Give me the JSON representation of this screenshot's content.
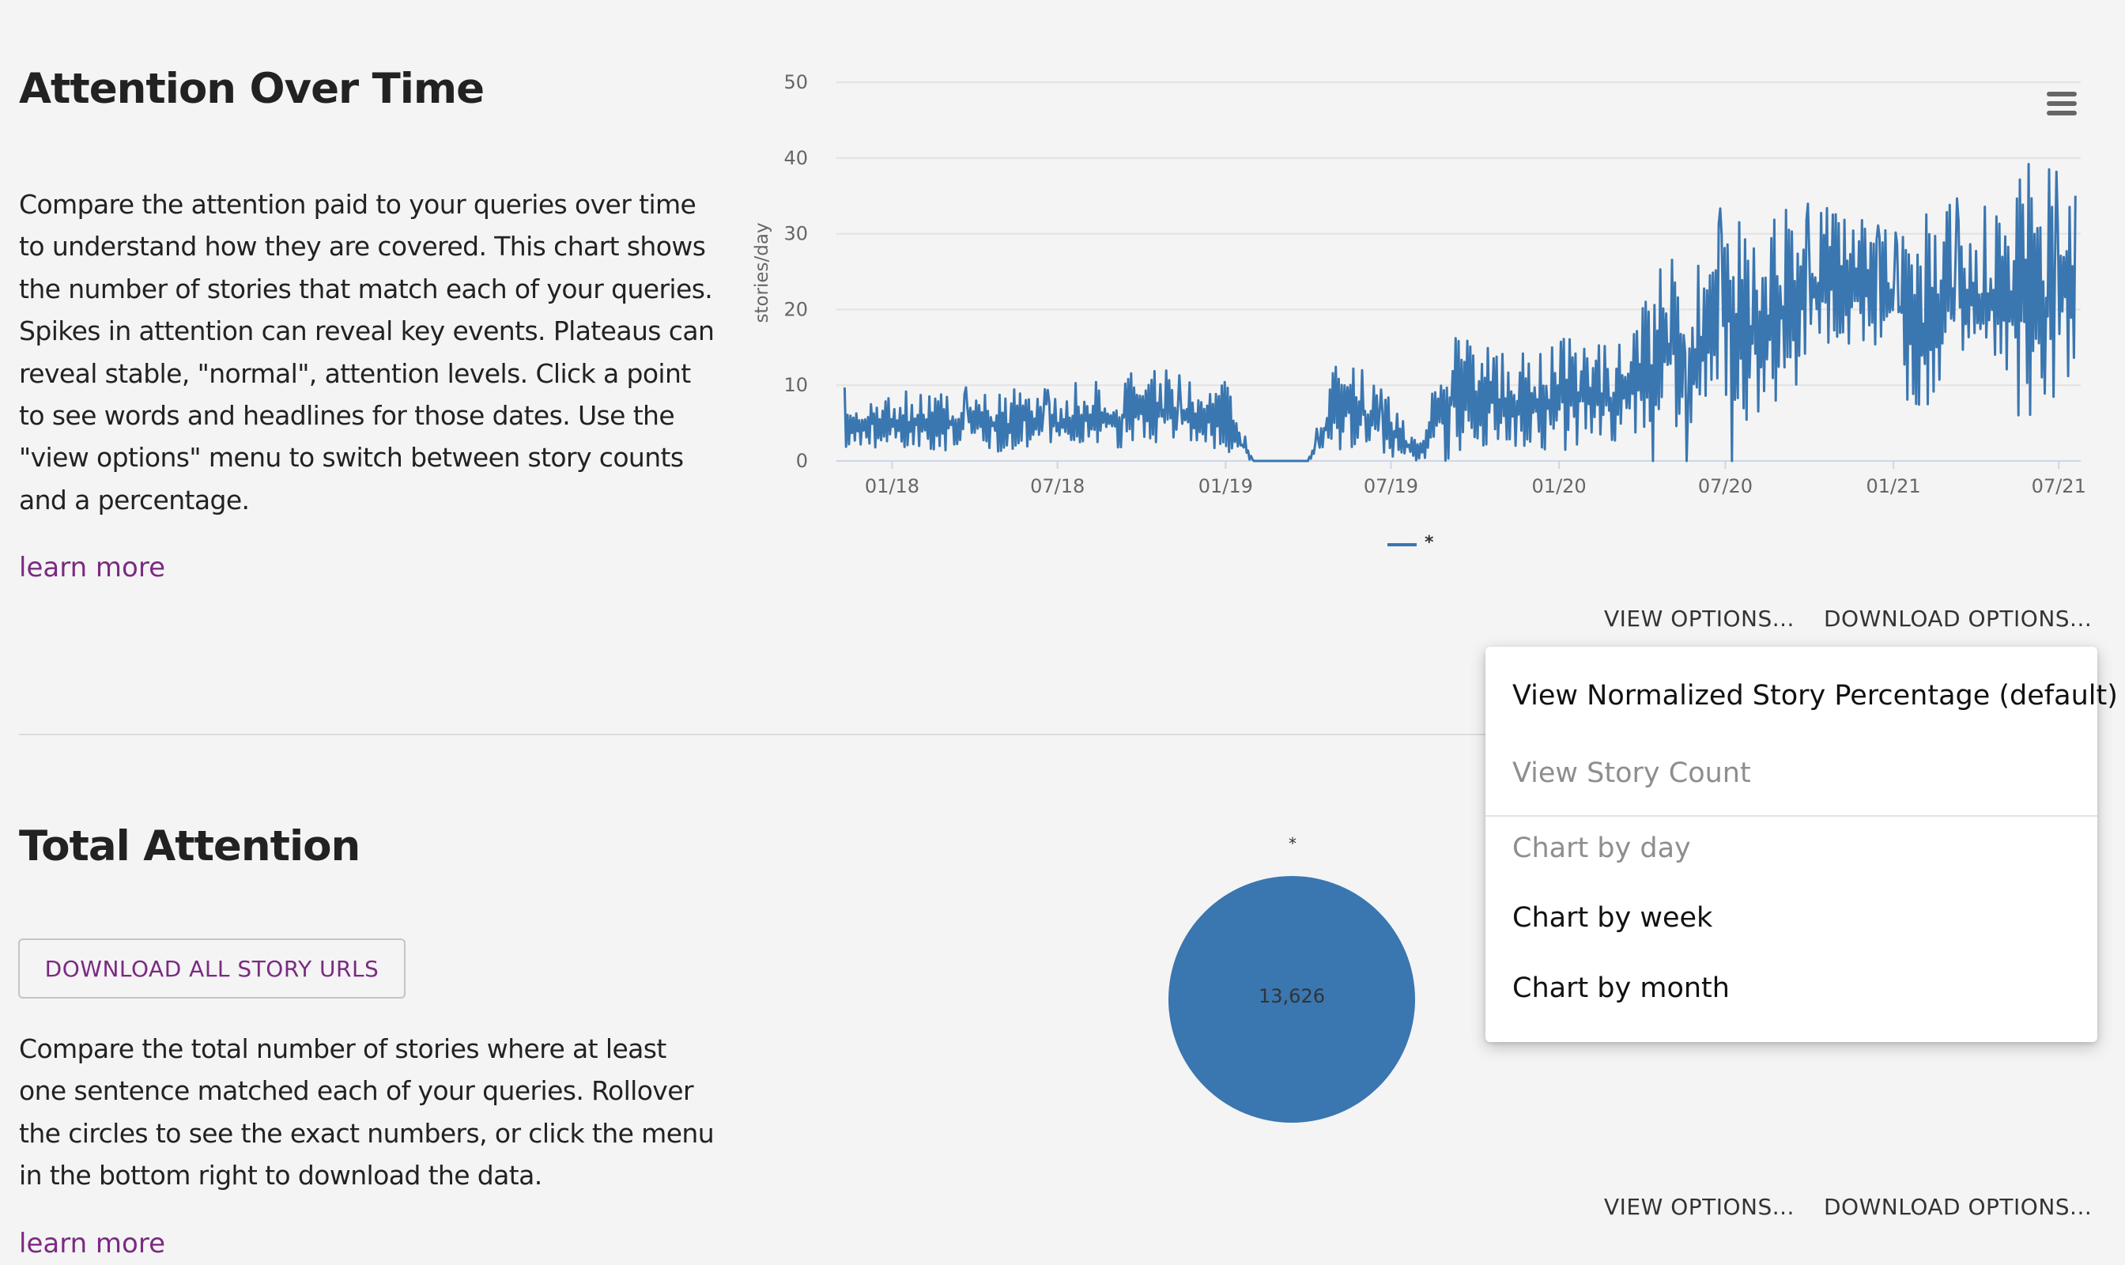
{
  "attention_over_time": {
    "title": "Attention Over Time",
    "description": "Compare the attention paid to your queries over time to understand how they are covered. This chart shows the number of stories that match each of your queries. Spikes in attention can reveal key events. Plateaus can reveal stable, \"normal\", attention levels. Click a point to see words and headlines for those dates. Use the \"view options\" menu to switch between story counts and a percentage.",
    "learn_more": "learn more",
    "view_options": "VIEW OPTIONS...",
    "download_options": "DOWNLOAD OPTIONS..."
  },
  "total_attention": {
    "title": "Total Attention",
    "download_button": "DOWNLOAD ALL STORY URLS",
    "description": "Compare the total number of stories where at least one sentence matched each of your queries. Rollover the circles to see the exact numbers, or click the menu in the bottom right to download the data.",
    "learn_more": "learn more",
    "bubble_label": "*",
    "bubble_value": "13,626",
    "view_options": "VIEW OPTIONS...",
    "download_options": "DOWNLOAD OPTIONS..."
  },
  "view_menu": {
    "items": [
      {
        "label": "View Normalized Story Percentage (default)",
        "state": "active"
      },
      {
        "label": "View Story Count",
        "state": "disabled"
      },
      {
        "label": "Chart by day",
        "state": "disabled"
      },
      {
        "label": "Chart by week",
        "state": "active"
      },
      {
        "label": "Chart by month",
        "state": "active"
      }
    ]
  },
  "colors": {
    "series": "#3a76b0",
    "link": "#7b2a82",
    "background": "#f4f4f4"
  },
  "chart_menu_icon": "hamburger-menu-icon",
  "chart_data": {
    "type": "line",
    "title": "",
    "xlabel": "",
    "ylabel": "stories/day",
    "ylim": [
      0,
      50
    ],
    "yticks": [
      0,
      10,
      20,
      30,
      40,
      50
    ],
    "xlim": [
      "2017-11-01",
      "2021-07-25"
    ],
    "xticks": [
      "01/18",
      "07/18",
      "01/19",
      "07/19",
      "01/20",
      "07/20",
      "01/21",
      "07/21"
    ],
    "grid": true,
    "legend": "bottom-center",
    "series": [
      {
        "name": "*",
        "color": "#3a76b0",
        "x": [
          "2017-11-01",
          "2017-12-01",
          "2018-01-01",
          "2018-02-01",
          "2018-03-01",
          "2018-04-01",
          "2018-05-01",
          "2018-06-01",
          "2018-07-01",
          "2018-08-01",
          "2018-09-01",
          "2018-10-01",
          "2018-11-01",
          "2018-12-01",
          "2019-01-01",
          "2019-02-01",
          "2019-03-01",
          "2019-04-01",
          "2019-05-01",
          "2019-06-01",
          "2019-07-01",
          "2019-08-01",
          "2019-09-01",
          "2019-10-01",
          "2019-11-01",
          "2019-12-01",
          "2020-01-01",
          "2020-02-01",
          "2020-03-01",
          "2020-04-01",
          "2020-05-01",
          "2020-06-01",
          "2020-07-01",
          "2020-08-01",
          "2020-09-01",
          "2020-10-01",
          "2020-11-01",
          "2020-12-01",
          "2021-01-01",
          "2021-02-01",
          "2021-03-01",
          "2021-04-01",
          "2021-05-01",
          "2021-06-01",
          "2021-07-01",
          "2021-07-25"
        ],
        "low": [
          0,
          2,
          1,
          2,
          1,
          2,
          1,
          2,
          1,
          2,
          1,
          3,
          2,
          2,
          0,
          0,
          0,
          0,
          1,
          2,
          0,
          0,
          0,
          2,
          2,
          2,
          1,
          2,
          2,
          3,
          4,
          5,
          6,
          5,
          8,
          12,
          15,
          14,
          15,
          0,
          10,
          12,
          13,
          0,
          10,
          12
        ],
        "high": [
          10,
          9,
          10,
          9,
          9,
          10,
          9,
          10,
          9,
          11,
          10,
          13,
          12,
          10,
          11,
          0,
          0,
          0,
          13,
          12,
          8,
          2,
          17,
          16,
          15,
          14,
          16,
          17,
          15,
          20,
          28,
          26,
          35,
          30,
          33,
          34,
          33,
          32,
          30,
          32,
          35,
          34,
          33,
          40,
          38,
          37
        ]
      }
    ]
  }
}
